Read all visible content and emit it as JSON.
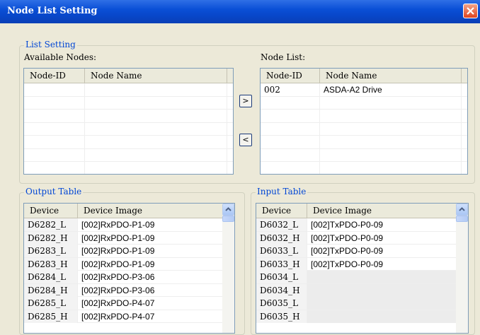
{
  "window": {
    "title": "Node List Setting"
  },
  "list_setting": {
    "group_label": "List Setting",
    "available_label": "Available Nodes:",
    "nodelist_label": "Node List:",
    "columns": [
      "Node-ID",
      "Node Name"
    ],
    "available_rows": [],
    "node_rows": [
      {
        "id": "002",
        "name": "ASDA-A2 Drive"
      }
    ],
    "add_button": ">",
    "remove_button": "<"
  },
  "output_table": {
    "group_label": "Output Table",
    "columns": [
      "Device",
      "Device Image"
    ],
    "rows": [
      {
        "device": "D6282_L",
        "image": "[002]RxPDO-P1-09"
      },
      {
        "device": "D6282_H",
        "image": "[002]RxPDO-P1-09"
      },
      {
        "device": "D6283_L",
        "image": "[002]RxPDO-P1-09"
      },
      {
        "device": "D6283_H",
        "image": "[002]RxPDO-P1-09"
      },
      {
        "device": "D6284_L",
        "image": "[002]RxPDO-P3-06"
      },
      {
        "device": "D6284_H",
        "image": "[002]RxPDO-P3-06"
      },
      {
        "device": "D6285_L",
        "image": "[002]RxPDO-P4-07"
      },
      {
        "device": "D6285_H",
        "image": "[002]RxPDO-P4-07"
      }
    ]
  },
  "input_table": {
    "group_label": "Input Table",
    "columns": [
      "Device",
      "Device Image"
    ],
    "rows": [
      {
        "device": "D6032_L",
        "image": "[002]TxPDO-P0-09"
      },
      {
        "device": "D6032_H",
        "image": "[002]TxPDO-P0-09"
      },
      {
        "device": "D6033_L",
        "image": "[002]TxPDO-P0-09"
      },
      {
        "device": "D6033_H",
        "image": "[002]TxPDO-P0-09"
      },
      {
        "device": "D6034_L",
        "image": ""
      },
      {
        "device": "D6034_H",
        "image": ""
      },
      {
        "device": "D6035_L",
        "image": ""
      },
      {
        "device": "D6035_H",
        "image": ""
      }
    ]
  },
  "colors": {
    "titlebar": "#0a4fd6",
    "group_label": "#0046d5",
    "dialog_bg": "#ece9d8"
  }
}
